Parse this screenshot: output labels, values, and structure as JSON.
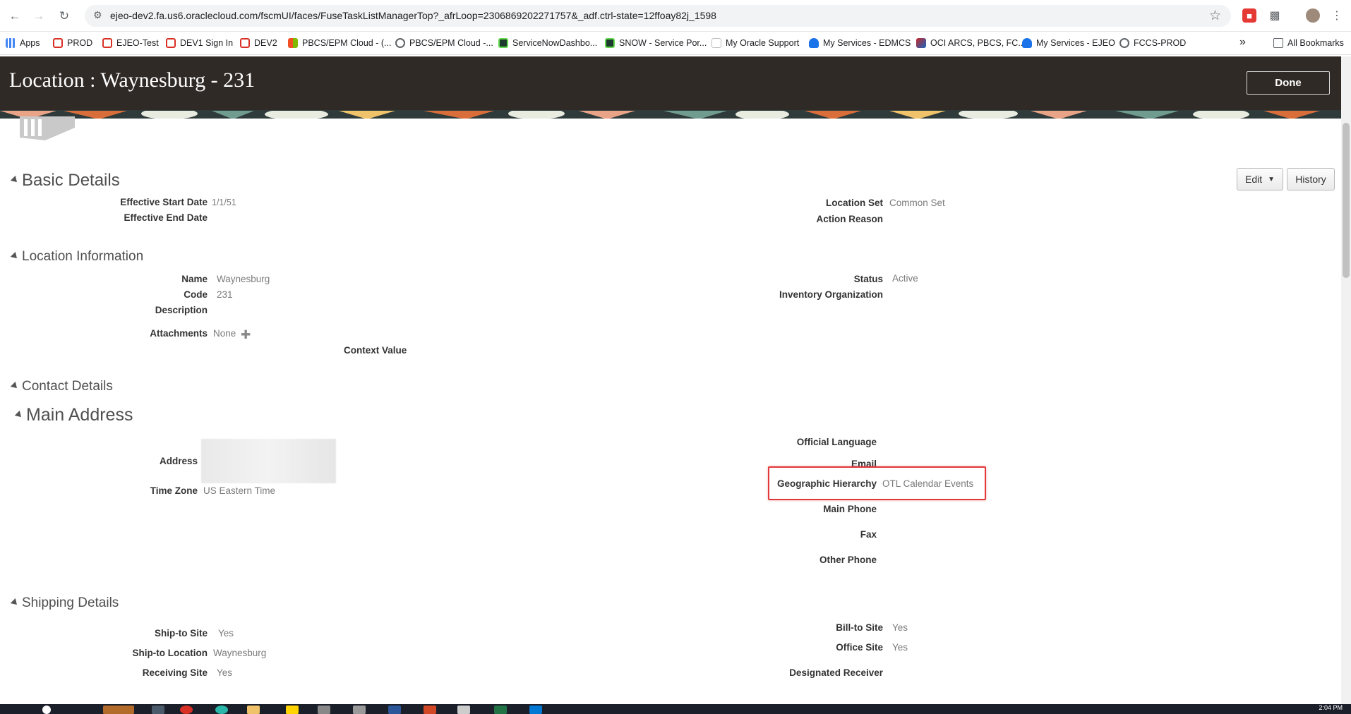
{
  "browser": {
    "url": "ejeo-dev2.fa.us6.oraclecloud.com/fscmUI/faces/FuseTaskListManagerTop?_afrLoop=2306869202271757&_adf.ctrl-state=12ffoay82j_1598",
    "bookmarks": [
      {
        "label": "Apps",
        "color": "#4285f4"
      },
      {
        "label": "PROD",
        "color": "#d93025"
      },
      {
        "label": "EJEO-Test",
        "color": "#d93025"
      },
      {
        "label": "DEV1 Sign In",
        "color": "#d93025"
      },
      {
        "label": "DEV2",
        "color": "#d93025"
      },
      {
        "label": "PBCS/EPM Cloud - (...",
        "color": "#f4b400"
      },
      {
        "label": "PBCS/EPM Cloud -...",
        "color": "#5f6368"
      },
      {
        "label": "ServiceNowDashbo...",
        "color": "#2e7d32"
      },
      {
        "label": "SNOW - Service Por...",
        "color": "#2e7d32"
      },
      {
        "label": "My Oracle Support",
        "color": "#bdbdbd"
      },
      {
        "label": "My Services - EDMCS",
        "color": "#1a73e8"
      },
      {
        "label": "OCI ARCS, PBCS, FC...",
        "color": "#c62828"
      },
      {
        "label": "My Services - EJEO",
        "color": "#1a73e8"
      },
      {
        "label": "FCCS-PROD",
        "color": "#5f6368"
      }
    ],
    "all_bookmarks": "All Bookmarks",
    "more_chevron": "»"
  },
  "header": {
    "title": "Location : Waynesburg - 231",
    "done_label": "Done"
  },
  "actions": {
    "edit_label": "Edit",
    "history_label": "History"
  },
  "basic_details": {
    "heading": "Basic Details",
    "effective_start_date_label": "Effective Start Date",
    "effective_start_date": "1/1/51",
    "effective_end_date_label": "Effective End Date",
    "effective_end_date": "",
    "location_set_label": "Location Set",
    "location_set": "Common Set",
    "action_reason_label": "Action Reason",
    "action_reason": ""
  },
  "location_information": {
    "heading": "Location Information",
    "name_label": "Name",
    "name": "Waynesburg",
    "code_label": "Code",
    "code": "231",
    "description_label": "Description",
    "description": "",
    "attachments_label": "Attachments",
    "attachments": "None",
    "context_value_label": "Context Value",
    "status_label": "Status",
    "status": "Active",
    "inventory_org_label": "Inventory Organization",
    "inventory_org": ""
  },
  "contact_details": {
    "heading": "Contact Details"
  },
  "main_address": {
    "heading": "Main Address",
    "address_label": "Address",
    "time_zone_label": "Time Zone",
    "time_zone": "US Eastern Time",
    "official_language_label": "Official Language",
    "email_label": "Email",
    "geographic_hierarchy_label": "Geographic Hierarchy",
    "geographic_hierarchy": "OTL Calendar Events",
    "main_phone_label": "Main Phone",
    "fax_label": "Fax",
    "other_phone_label": "Other Phone"
  },
  "shipping_details": {
    "heading": "Shipping Details",
    "ship_to_site_label": "Ship-to Site",
    "ship_to_site": "Yes",
    "ship_to_location_label": "Ship-to Location",
    "ship_to_location": "Waynesburg",
    "receiving_site_label": "Receiving Site",
    "receiving_site": "Yes",
    "bill_to_site_label": "Bill-to Site",
    "bill_to_site": "Yes",
    "office_site_label": "Office Site",
    "office_site": "Yes",
    "designated_receiver_label": "Designated Receiver"
  },
  "taskbar": {
    "clock": "2:04 PM"
  }
}
